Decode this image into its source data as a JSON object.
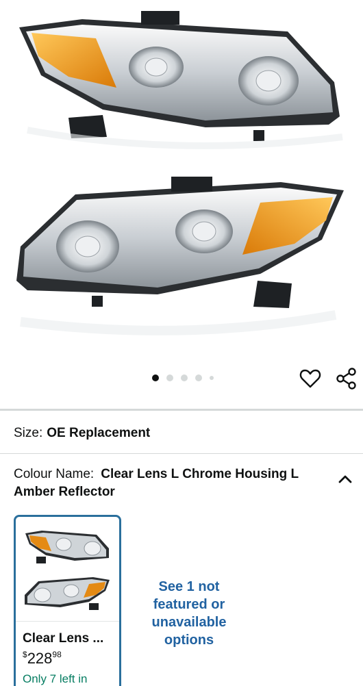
{
  "carousel": {
    "total_images": 5,
    "active_index": 0
  },
  "icons": {
    "favorite": "heart-icon",
    "share": "share-icon",
    "collapse": "chevron-up-icon"
  },
  "size": {
    "label": "Size:",
    "value": "OE Replacement"
  },
  "colour": {
    "label": "Colour Name:",
    "value": "Clear Lens L Chrome Housing L Amber Reflector"
  },
  "swatch": {
    "name": "Clear Lens ...",
    "price_symbol": "$",
    "price_whole": "228",
    "price_fraction": "98",
    "stock": "Only 7 left in"
  },
  "unavailable_link": "See 1 not featured or unavailable options",
  "colors": {
    "accent_border": "#2a6f9c",
    "link": "#2162a1",
    "stock_green": "#067d62",
    "amber": "#f0a020"
  }
}
